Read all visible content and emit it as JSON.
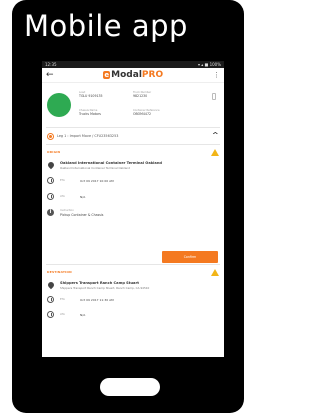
{
  "page_title": "Mobile app",
  "status_bar": {
    "time": "12:35",
    "icons": "▾ ▴ ■ 100%"
  },
  "appbar": {
    "back_icon": "arrow-left-icon",
    "logo": {
      "e": "e",
      "modal": "Modal",
      "pro": "PRO"
    },
    "menu_icon": "more-vert-icon"
  },
  "driver": {
    "fields": [
      {
        "label": "Load",
        "value": "TGLU 9109135"
      },
      {
        "label": "Truck Number",
        "value": "9821230"
      },
      {
        "label": "Chassis Name",
        "value": "Trucks Motors"
      },
      {
        "label": "Container Reference",
        "value": "OBOM4472"
      }
    ]
  },
  "leg": {
    "title": "Leg 1 : Import Move / CFU23563253"
  },
  "origin": {
    "section_label": "ORIGIN",
    "place_name": "Oakland International Container Terminal Oakland",
    "place_address": "Oakland International Container Terminal Oakland",
    "eta_label": "ETA",
    "eta_value": "Oct 09 2017 10:00 AM",
    "ata_label": "ATA",
    "ata_value": "N/A",
    "instruction_label": "Instruction",
    "instruction_value": "Pickup Container & Chassis"
  },
  "action_button": {
    "label": "Confirm"
  },
  "destination": {
    "section_label": "DESTINATION",
    "place_name": "Shippers Transport Ranch Camp Stuart",
    "place_address": "Shippers Transport Ranch Camp Stuart, Ranch Camp, CA 94510",
    "eta_label": "ETA",
    "eta_value": "Oct 09 2017 11:30 AM",
    "ata_label": "ATA",
    "ata_value": "N/A"
  },
  "colors": {
    "accent": "#f47920",
    "avatar": "#2eaa52",
    "warning": "#f2b517",
    "device": "#000000"
  }
}
